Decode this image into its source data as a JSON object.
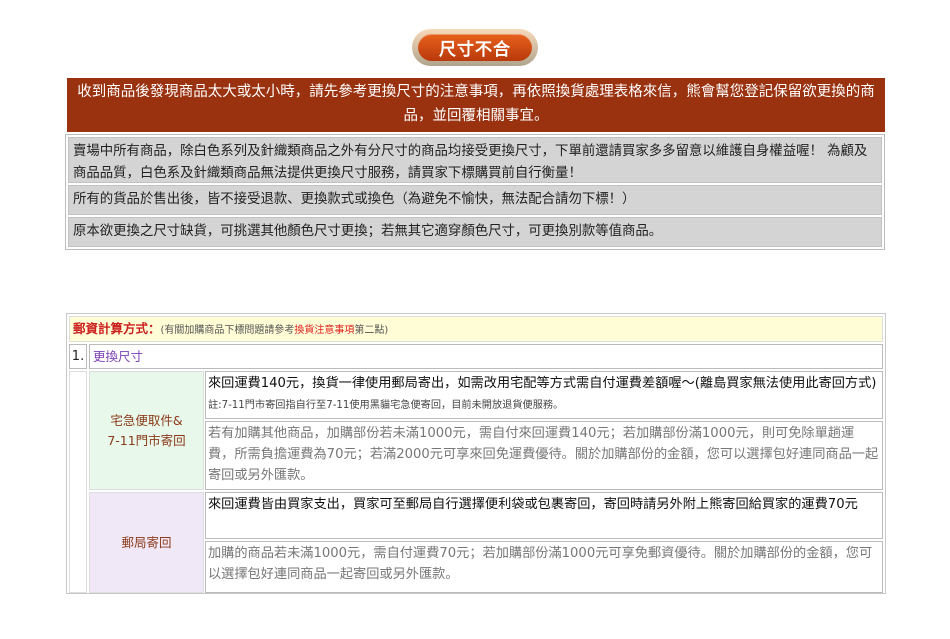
{
  "title": "尺寸不合",
  "notice": "收到商品後發現商品太大或太小時，請先參考更換尺寸的注意事項，再依照換貨處理表格來信，熊會幫您登記保留欲更換的商品，並回覆相關事宜。",
  "rules": [
    "賣場中所有商品，除白色系列及針織類商品之外有分尺寸的商品均接受更換尺寸，下單前還請買家多多留意以維護自身權益喔！ 為顧及商品品質，白色系及針織類商品無法提供更換尺寸服務，請買家下標購買前自行衡量！",
    "所有的貨品於售出後，皆不接受退款、更換款式或換色（為避免不愉快，無法配合請勿下標！）",
    "原本欲更換之尺寸缺貨，可挑選其他顏色尺寸更換；若無其它適穿顏色尺寸，可更換別款等值商品。"
  ],
  "postage": {
    "label": "郵資計算方式：",
    "note_pre": "(有關加購商品下標問題請參考",
    "note_link": "換貨注意事項",
    "note_post": "第二點)",
    "item_no": "1.",
    "item_title": "更換尺寸",
    "methods": [
      {
        "name": "宅急便取件&\n7-11門市寄回",
        "main": "來回運費140元，換貨一律使用郵局寄出，如需改用宅配等方式需自付運費差額喔～(離島買家無法使用此寄回方式) ",
        "fine": "註:7-11門市寄回指自行至7-11使用黑貓宅急便寄回，目前未開放退貨便服務。",
        "sub": "若有加購其他商品，加購部份若未滿1000元，需自付來回運費140元；若加購部份滿1000元，則可免除單趟運費，所需負擔運費為70元；若滿2000元可享來回免運費優待。關於加購部份的金額，您可以選擇包好連同商品一起寄回或另外匯款。"
      },
      {
        "name": "郵局寄回",
        "main": "來回運費皆由買家支出，買家可至郵局自行選擇便利袋或包裹寄回，寄回時請另外附上熊寄回給買家的運費70元",
        "sub": "加購的商品若未滿1000元，需自付運費70元；若加購部份滿1000元可享免郵資優待。關於加購部份的金額，您可以選擇包好連同商品一起寄回或另外匯款。"
      }
    ]
  }
}
